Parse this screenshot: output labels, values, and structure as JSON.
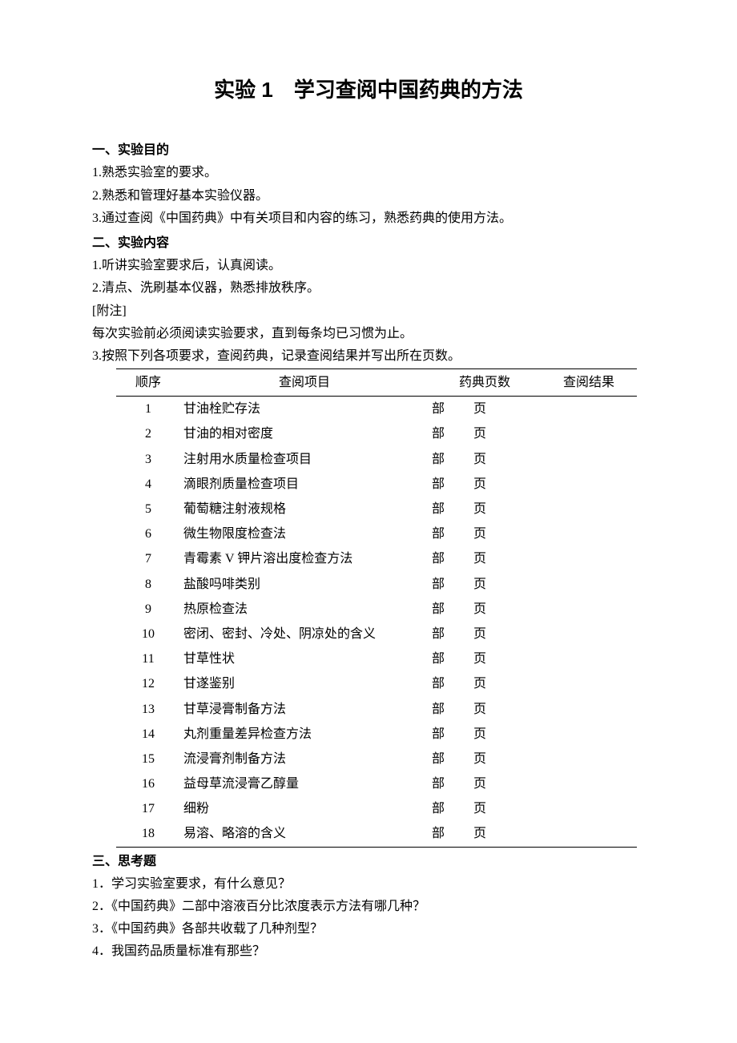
{
  "title": "实验 1　学习查阅中国药典的方法",
  "section1": {
    "heading": "一、实验目的",
    "items": [
      "1.熟悉实验室的要求。",
      "2.熟悉和管理好基本实验仪器。",
      "3.通过查阅《中国药典》中有关项目和内容的练习，熟悉药典的使用方法。"
    ]
  },
  "section2": {
    "heading": "二、实验内容",
    "items": [
      "1.听讲实验室要求后，认真阅读。",
      "2.清点、洗刷基本仪器，熟悉排放秩序。"
    ],
    "note_label": "[附注]",
    "note_text": "每次实验前必须阅读实验要求，直到每条均已习惯为止。",
    "item3": "3.按照下列各项要求，查阅药典，记录查阅结果并写出所在页数。"
  },
  "table": {
    "headers": {
      "seq": "顺序",
      "item": "查阅项目",
      "pages": "药典页数",
      "result": "查阅结果"
    },
    "page_part": "部",
    "page_page": "页",
    "rows": [
      {
        "seq": "1",
        "item": "甘油栓贮存法"
      },
      {
        "seq": "2",
        "item": "甘油的相对密度"
      },
      {
        "seq": "3",
        "item": "注射用水质量检查项目"
      },
      {
        "seq": "4",
        "item": "滴眼剂质量检查项目"
      },
      {
        "seq": "5",
        "item": "葡萄糖注射液规格"
      },
      {
        "seq": "6",
        "item": "微生物限度检查法"
      },
      {
        "seq": "7",
        "item": "青霉素 V 钾片溶出度检查方法"
      },
      {
        "seq": "8",
        "item": "盐酸吗啡类别"
      },
      {
        "seq": "9",
        "item": "热原检查法"
      },
      {
        "seq": "10",
        "item": "密闭、密封、冷处、阴凉处的含义"
      },
      {
        "seq": "11",
        "item": "甘草性状"
      },
      {
        "seq": "12",
        "item": "甘遂鉴别"
      },
      {
        "seq": "13",
        "item": "甘草浸膏制备方法"
      },
      {
        "seq": "14",
        "item": "丸剂重量差异检查方法"
      },
      {
        "seq": "15",
        "item": "流浸膏剂制备方法"
      },
      {
        "seq": "16",
        "item": "益母草流浸膏乙醇量"
      },
      {
        "seq": "17",
        "item": "细粉"
      },
      {
        "seq": "18",
        "item": "易溶、略溶的含义"
      }
    ]
  },
  "section3": {
    "heading": "三、思考题",
    "items": [
      "1．学习实验室要求，有什么意见？",
      "2．《中国药典》二部中溶液百分比浓度表示方法有哪几种？",
      "3．《中国药典》各部共收载了几种剂型？",
      "4．我国药品质量标准有那些？"
    ]
  }
}
